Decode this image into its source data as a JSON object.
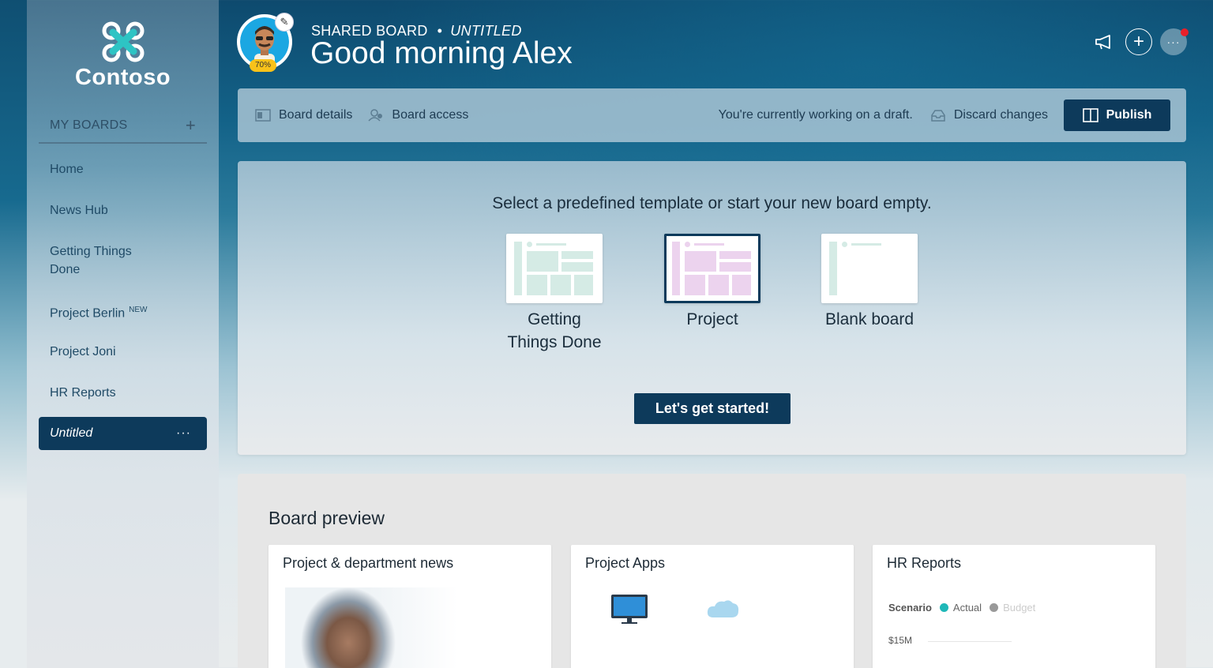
{
  "brand": {
    "name": "Contoso",
    "accent": "#0d3a5b",
    "logo_icon": "drone-logo-icon"
  },
  "sidebar": {
    "section_label": "MY BOARDS",
    "add_icon": "plus-icon",
    "items": [
      {
        "label": "Home"
      },
      {
        "label": "News Hub"
      },
      {
        "label": "Getting Things Done"
      },
      {
        "label": "Project Berlin",
        "badge": "NEW"
      },
      {
        "label": "Project Joni"
      },
      {
        "label": "HR Reports"
      }
    ],
    "active_item": {
      "label": "Untitled",
      "more": "···"
    }
  },
  "header": {
    "avatar_badge": "70%",
    "board_type": "SHARED BOARD",
    "board_name": "UNTITLED",
    "greeting": "Good morning Alex",
    "notification_dot_color": "#e8202a"
  },
  "toolbar": {
    "board_details": "Board details",
    "board_access": "Board access",
    "draft_notice": "You're currently working on a draft.",
    "discard": "Discard changes",
    "publish": "Publish"
  },
  "template_panel": {
    "prompt": "Select a predefined template or start your new board empty.",
    "templates": [
      {
        "label": "Getting Things Done",
        "color": "#d5ebe5"
      },
      {
        "label": "Project",
        "color": "#ecd3ee",
        "selected": true
      },
      {
        "label": "Blank board",
        "color": "#d5ebe5"
      }
    ],
    "start_button": "Let's get started!"
  },
  "preview": {
    "title": "Board preview",
    "cards": [
      {
        "title": "Project & department news"
      },
      {
        "title": "Project Apps"
      },
      {
        "title": "HR Reports",
        "legend_label": "Scenario",
        "series": [
          "Actual",
          "Budget"
        ],
        "axis_value": "$15M"
      }
    ]
  }
}
